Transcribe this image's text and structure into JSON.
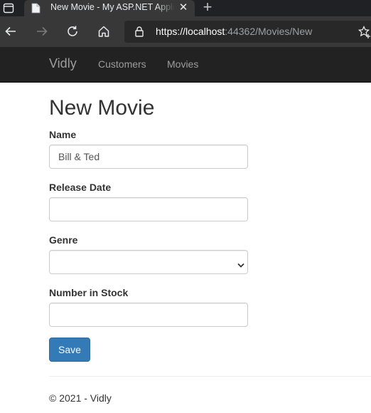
{
  "browser": {
    "tab_title": "New Movie - My ASP.NET Application",
    "url_scheme": "https://",
    "url_host": "localhost",
    "url_rest": ":44362/Movies/New",
    "icons": [
      "tab-actions-icon",
      "page-favicon",
      "close-icon",
      "new-tab-icon",
      "back-arrow-icon",
      "forward-arrow-icon",
      "refresh-icon",
      "home-icon",
      "lock-icon",
      "favorites-star-icon"
    ]
  },
  "navbar": {
    "brand": "Vidly",
    "links": [
      "Customers",
      "Movies"
    ],
    "background": "#222222",
    "link_color": "#9d9d9d"
  },
  "form": {
    "title": "New Movie",
    "name_label": "Name",
    "name_value": "Bill & Ted",
    "release_date_label": "Release Date",
    "release_date_value": "",
    "genre_label": "Genre",
    "genre_selected": "",
    "stock_label": "Number in Stock",
    "stock_value": "",
    "save_label": "Save",
    "save_color": "#337ab7"
  },
  "footer": {
    "text": "© 2021 - Vidly"
  }
}
